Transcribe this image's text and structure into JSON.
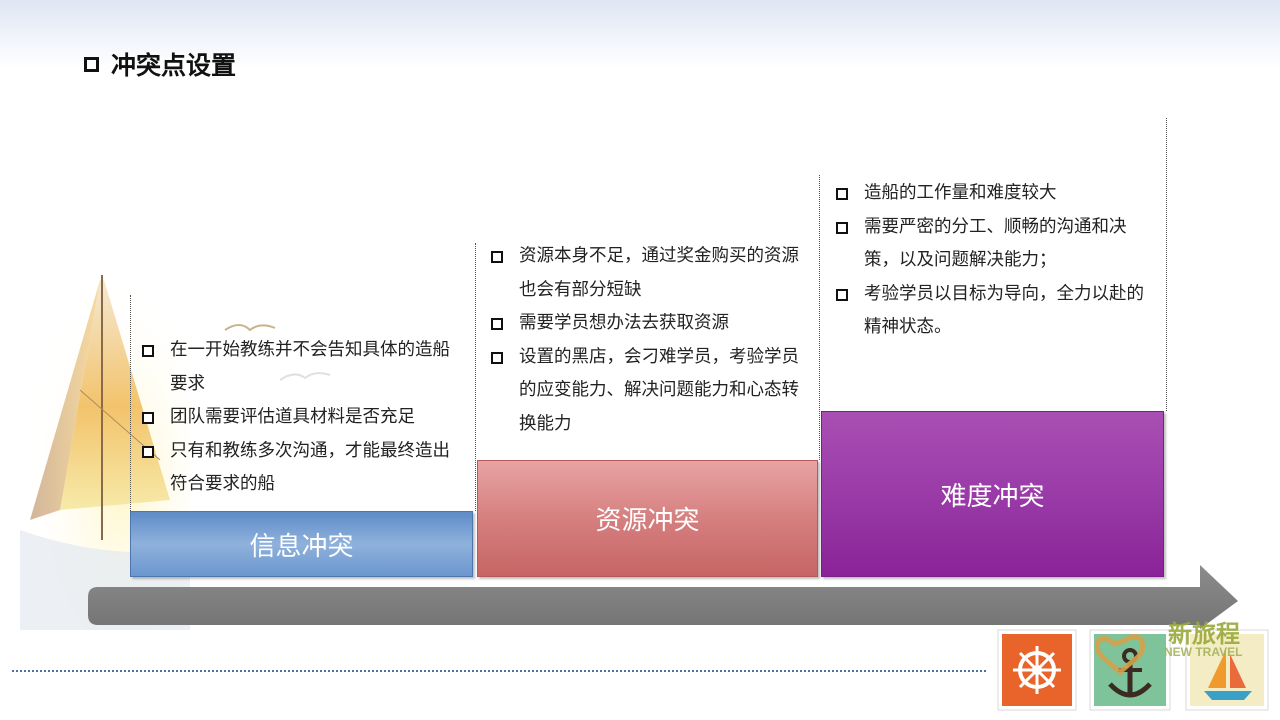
{
  "title": "冲突点设置",
  "columns": [
    {
      "label": "信息冲突",
      "color": "#7ea3d6",
      "items": [
        "在一开始教练并不会告知具体的造船要求",
        "团队需要评估道具材料是否充足",
        "只有和教练多次沟通，才能最终造出符合要求的船"
      ]
    },
    {
      "label": "资源冲突",
      "color": "#d98282",
      "items": [
        "资源本身不足，通过奖金购买的资源也会有部分短缺",
        "需要学员想办法去获取资源",
        "设置的黑店，会刁难学员，考验学员的应变能力、解决问题能力和心态转换能力"
      ]
    },
    {
      "label": "难度冲突",
      "color": "#9b3aa8",
      "items": [
        "造船的工作量和难度较大",
        "需要严密的分工、顺畅的沟通和决策，以及问题解决能力；",
        "考验学员以目标为导向，全力以赴的精神状态。"
      ]
    }
  ],
  "logo": {
    "cn": "新旅程",
    "en": "NEW TRAVEL"
  },
  "icons": {
    "title_bullet": "square-bullet-icon",
    "arrow": "timeline-arrow",
    "boat": "sailboat-image",
    "logo_tiles": [
      "ship-wheel-icon",
      "anchor-icon",
      "sailboat-icon"
    ]
  },
  "colors": {
    "arrow": "#808080",
    "dots": "#4a6fa5"
  }
}
